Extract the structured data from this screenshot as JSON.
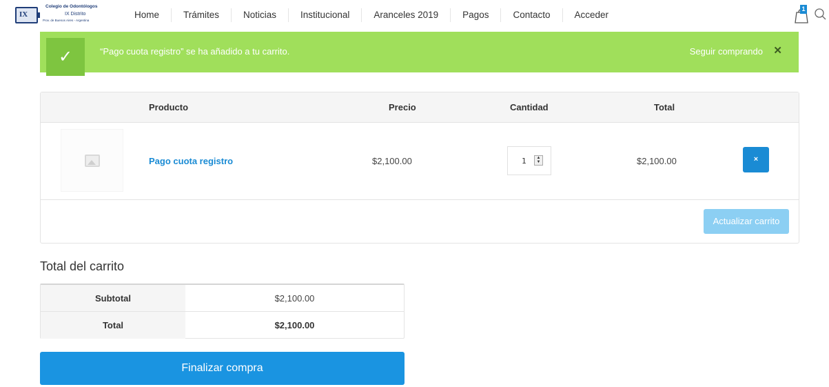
{
  "header": {
    "logo": {
      "mark": "IX",
      "line1": "Colegio de Odontólogos",
      "line2": "IX Distrito",
      "line3": "Prov. de Buenos Aires - Argentina"
    },
    "nav": [
      "Home",
      "Trámites",
      "Noticias",
      "Institucional",
      "Aranceles 2019",
      "Pagos",
      "Contacto",
      "Acceder"
    ],
    "cart_count": "1"
  },
  "notice": {
    "message": "“Pago cuota registro” se ha añadido a tu carrito.",
    "link": "Seguir comprando",
    "close": "✕",
    "check": "✓"
  },
  "cart": {
    "headers": {
      "product": "Producto",
      "price": "Precio",
      "quantity": "Cantidad",
      "total": "Total"
    },
    "items": [
      {
        "name": "Pago cuota registro",
        "price": "$2,100.00",
        "quantity": "1",
        "subtotal": "$2,100.00",
        "remove": "×"
      }
    ],
    "update_label": "Actualizar carrito"
  },
  "totals": {
    "title": "Total del carrito",
    "subtotal_label": "Subtotal",
    "subtotal_value": "$2,100.00",
    "total_label": "Total",
    "total_value": "$2,100.00"
  },
  "checkout_label": "Finalizar compra",
  "colors": {
    "notice_bg": "#a0df5b",
    "accent": "#1a8bd4",
    "checkout": "#1a94e1"
  }
}
